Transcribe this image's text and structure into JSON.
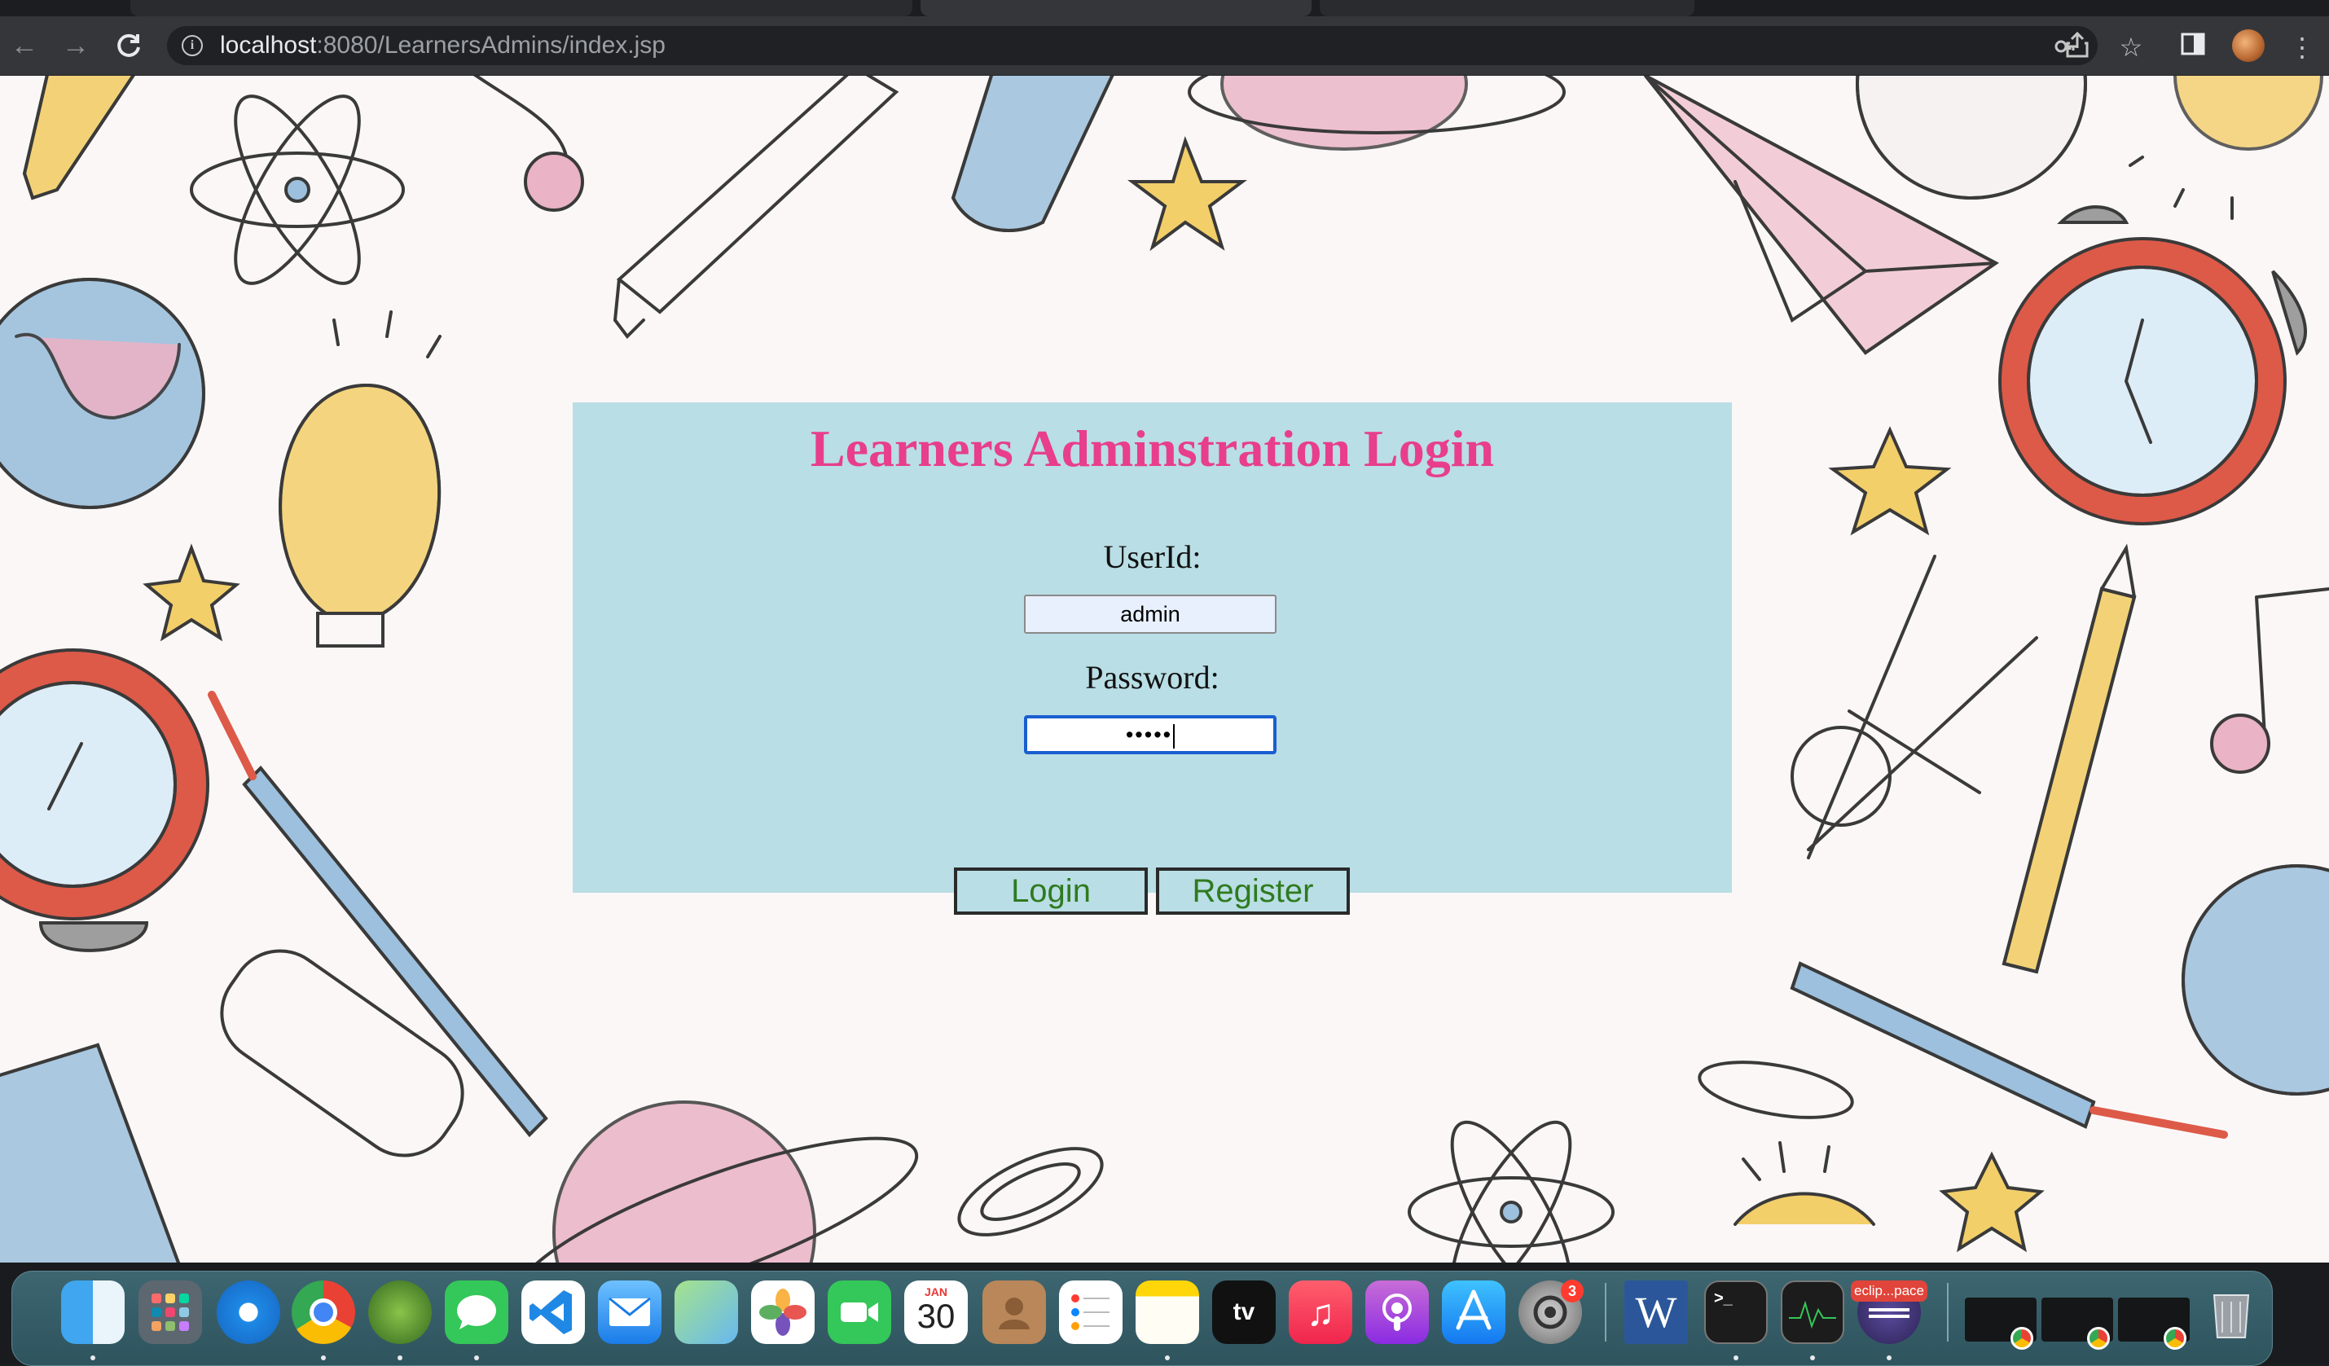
{
  "browser": {
    "url_host": "localhost",
    "url_rest": ":8080/LearnersAdmins/index.jsp"
  },
  "login": {
    "title": "Learners Adminstration Login",
    "userid_label": "UserId:",
    "userid_value": "admin",
    "password_label": "Password:",
    "password_masked": "•••••",
    "login_button": "Login",
    "register_button": "Register"
  },
  "dock": {
    "calendar_month": "JAN",
    "calendar_day": "30",
    "settings_badge": "3",
    "word_letter": "W",
    "eclipse_label": "eclip...pace",
    "colors": {
      "dock": "#2e545e",
      "panel": "#b9dee5",
      "title": "#e83e8c",
      "button_text": "#2f7a1f"
    }
  }
}
